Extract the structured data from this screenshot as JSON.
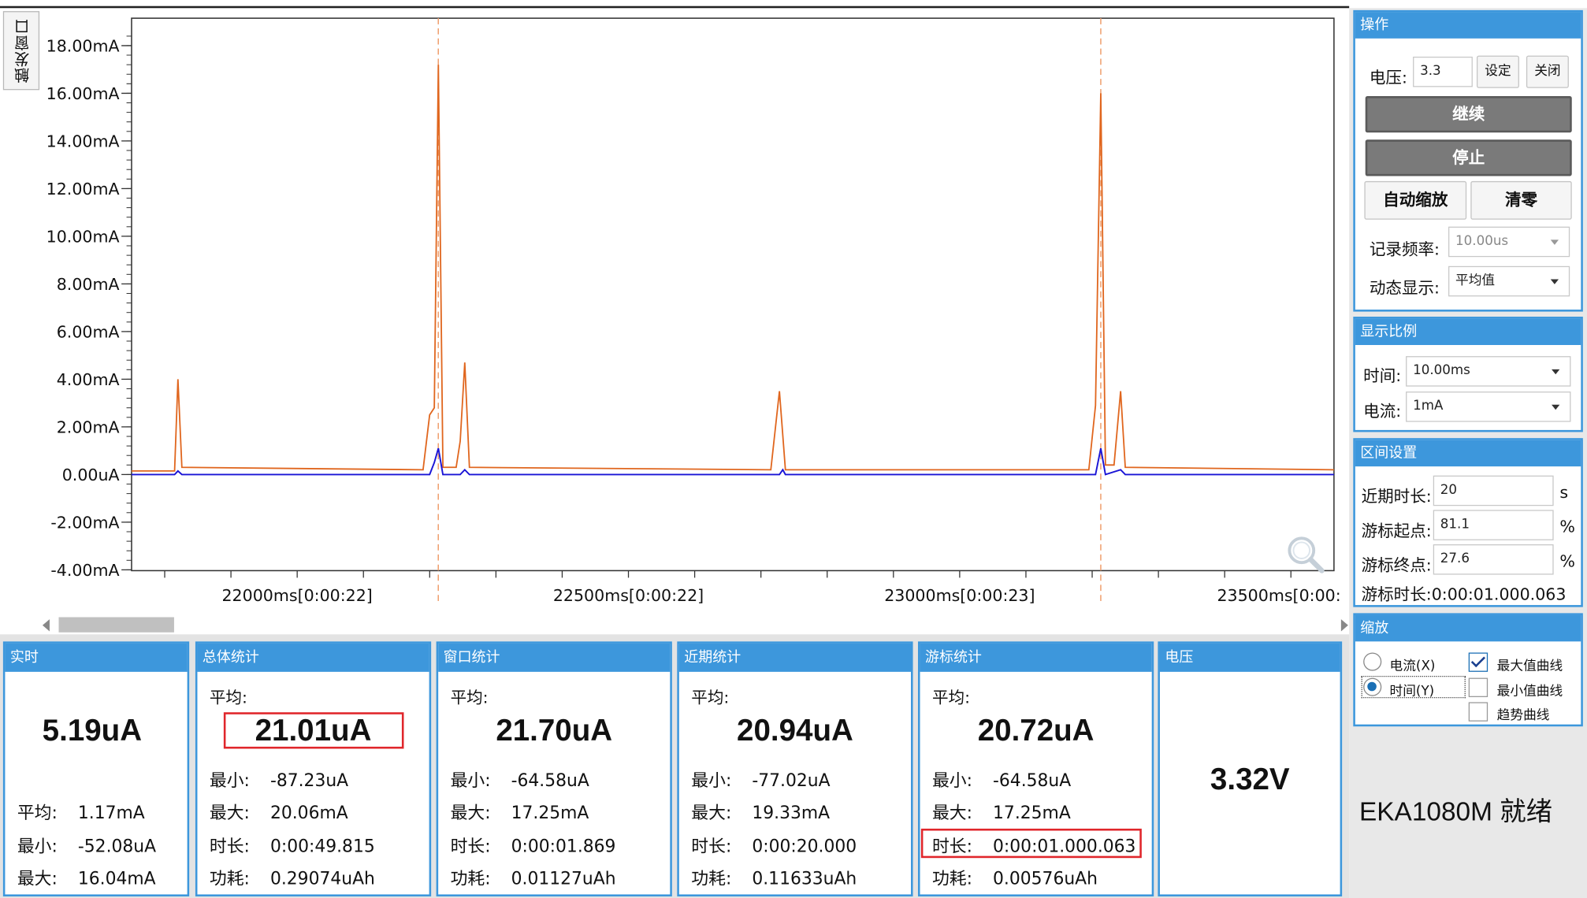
{
  "trigger_tab": {
    "label": "触发窗口"
  },
  "chart_data": {
    "type": "line",
    "y_ticks": [
      "18.00mA",
      "16.00mA",
      "14.00mA",
      "12.00mA",
      "10.00mA",
      "8.00mA",
      "6.00mA",
      "4.00mA",
      "2.00mA",
      "0.00uA",
      "-2.00mA",
      "-4.00mA"
    ],
    "ylim_mA": [
      -4,
      18.5
    ],
    "x_ticks": [
      {
        "t": 22000,
        "label": "22000ms[0:00:22]"
      },
      {
        "t": 22500,
        "label": "22500ms[0:00:22]"
      },
      {
        "t": 23000,
        "label": "23000ms[0:00:23]"
      },
      {
        "t": 23500,
        "label": "23500ms[0:00:"
      }
    ],
    "xlim_ms": [
      21750,
      23565
    ],
    "cursor_lines_ms": [
      22213,
      23213
    ],
    "series": [
      {
        "color": "#e0661e",
        "points": [
          [
            21750,
            0.15
          ],
          [
            21815,
            0.15
          ],
          [
            21820,
            4.0
          ],
          [
            21826,
            0.3
          ],
          [
            22190,
            0.2
          ],
          [
            22200,
            2.5
          ],
          [
            22207,
            2.8
          ],
          [
            22213,
            17.2
          ],
          [
            22220,
            0.3
          ],
          [
            22240,
            0.3
          ],
          [
            22246,
            1.4
          ],
          [
            22253,
            4.7
          ],
          [
            22260,
            0.3
          ],
          [
            22715,
            0.2
          ],
          [
            22728,
            3.5
          ],
          [
            22737,
            0.2
          ],
          [
            23195,
            0.2
          ],
          [
            23205,
            2.9
          ],
          [
            23213,
            16.0
          ],
          [
            23220,
            0.4
          ],
          [
            23233,
            0.4
          ],
          [
            23243,
            3.5
          ],
          [
            23250,
            0.3
          ],
          [
            23565,
            0.2
          ]
        ]
      },
      {
        "color": "#1a14d6",
        "points": [
          [
            21750,
            0.0
          ],
          [
            21815,
            0.0
          ],
          [
            21820,
            0.15
          ],
          [
            21826,
            0.0
          ],
          [
            22200,
            0.0
          ],
          [
            22207,
            0.5
          ],
          [
            22213,
            1.1
          ],
          [
            22220,
            0.0
          ],
          [
            22246,
            0.0
          ],
          [
            22253,
            0.2
          ],
          [
            22260,
            0.0
          ],
          [
            22728,
            0.0
          ],
          [
            22733,
            0.2
          ],
          [
            22737,
            0.0
          ],
          [
            23205,
            0.0
          ],
          [
            23213,
            1.1
          ],
          [
            23220,
            0.0
          ],
          [
            23243,
            0.2
          ],
          [
            23250,
            0.0
          ],
          [
            23565,
            0.0
          ]
        ]
      }
    ]
  },
  "stats": {
    "realtime": {
      "title": "实时",
      "big": "5.19uA",
      "rows": [
        [
          "平均:",
          "1.17mA"
        ],
        [
          "最小:",
          "-52.08uA"
        ],
        [
          "最大:",
          "16.04mA"
        ]
      ]
    },
    "overall": {
      "title": "总体统计",
      "avg_label": "平均:",
      "big": "21.01uA",
      "rows": [
        [
          "最小:",
          "-87.23uA"
        ],
        [
          "最大:",
          "20.06mA"
        ],
        [
          "时长:",
          "0:00:49.815"
        ],
        [
          "功耗:",
          "0.29074uAh"
        ]
      ]
    },
    "window": {
      "title": "窗口统计",
      "avg_label": "平均:",
      "big": "21.70uA",
      "rows": [
        [
          "最小:",
          "-64.58uA"
        ],
        [
          "最大:",
          "17.25mA"
        ],
        [
          "时长:",
          "0:00:01.869"
        ],
        [
          "功耗:",
          "0.01127uAh"
        ]
      ]
    },
    "recent": {
      "title": "近期统计",
      "avg_label": "平均:",
      "big": "20.94uA",
      "rows": [
        [
          "最小:",
          "-77.02uA"
        ],
        [
          "最大:",
          "19.33mA"
        ],
        [
          "时长:",
          "0:00:20.000"
        ],
        [
          "功耗:",
          "0.11633uAh"
        ]
      ]
    },
    "cursor": {
      "title": "游标统计",
      "avg_label": "平均:",
      "big": "20.72uA",
      "rows": [
        [
          "最小:",
          "-64.58uA"
        ],
        [
          "最大:",
          "17.25mA"
        ],
        [
          "时长:",
          "0:00:01.000.063"
        ],
        [
          "功耗:",
          "0.00576uAh"
        ]
      ]
    },
    "voltage": {
      "title": "电压",
      "value": "3.32V"
    }
  },
  "ops": {
    "title": "操作",
    "voltage_label": "电压:",
    "voltage_value": "3.3",
    "set_label": "设定",
    "close_label": "关闭",
    "continue_label": "继续",
    "stop_label": "停止",
    "autoscale_label": "自动缩放",
    "zero_label": "清零",
    "rate_label": "记录频率:",
    "rate_value": "10.00us",
    "dynamic_label": "动态显示:",
    "dynamic_value": "平均值"
  },
  "scale": {
    "title": "显示比例",
    "time_label": "时间:",
    "time_value": "10.00ms",
    "current_label": "电流:",
    "current_value": "1mA"
  },
  "range": {
    "title": "区间设置",
    "recent_label": "近期时长:",
    "recent_value": "20",
    "recent_unit": "s",
    "start_label": "游标起点:",
    "start_value": "81.1",
    "start_unit": "%",
    "end_label": "游标终点:",
    "end_value": "27.6",
    "end_unit": "%",
    "duration_text": "游标时长:0:00:01.000.063"
  },
  "zoom": {
    "title": "缩放",
    "radio_current": "电流(X)",
    "radio_time": "时间(Y)",
    "chk_max": "最大值曲线",
    "chk_min": "最小值曲线",
    "chk_trend": "趋势曲线"
  },
  "status_text": "EKA1080M  就绪"
}
